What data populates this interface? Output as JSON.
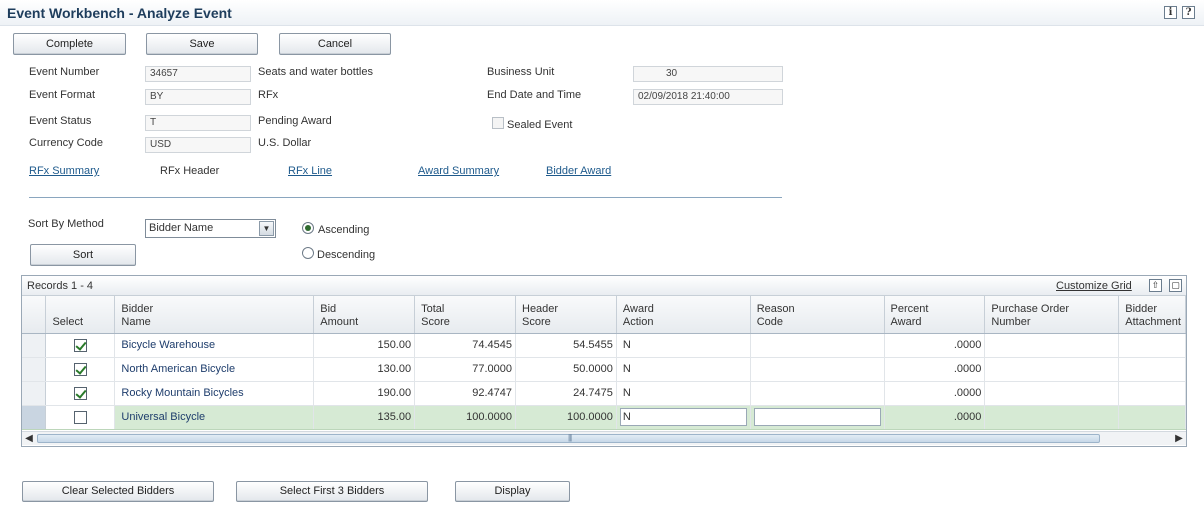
{
  "header": {
    "title": "Event Workbench - Analyze Event",
    "info_icon": "i",
    "help_icon": "?"
  },
  "toolbar": {
    "complete_label": "Complete",
    "save_label": "Save",
    "cancel_label": "Cancel"
  },
  "event": {
    "number_label": "Event Number",
    "number_value": "34657",
    "number_desc": "Seats and water bottles",
    "format_label": "Event Format",
    "format_value": "BY",
    "format_desc": "RFx",
    "status_label": "Event Status",
    "status_value": "T",
    "status_desc": "Pending Award",
    "currency_label": "Currency Code",
    "currency_value": "USD",
    "currency_desc": "U.S. Dollar",
    "business_unit_label": "Business Unit",
    "business_unit_value": "30",
    "end_date_label": "End Date and Time",
    "end_date_value": "02/09/2018 21:40:00",
    "sealed_label": "Sealed Event"
  },
  "nav_links": {
    "rfx_summary": "RFx Summary",
    "rfx_header": "RFx Header",
    "rfx_line": "RFx Line",
    "award_summary": "Award Summary",
    "bidder_award": "Bidder Award"
  },
  "sort": {
    "method_label": "Sort By Method",
    "method_value": "Bidder Name",
    "ascending_label": "Ascending",
    "descending_label": "Descending",
    "selected_order": "Ascending",
    "button_label": "Sort"
  },
  "grid": {
    "records_label": "Records 1 - 4",
    "customize_label": "Customize Grid",
    "columns": {
      "select": "Select",
      "bidder_name_1": "Bidder",
      "bidder_name_2": "Name",
      "bid_amount_1": "Bid",
      "bid_amount_2": "Amount",
      "total_score_1": "Total",
      "total_score_2": "Score",
      "header_score_1": "Header",
      "header_score_2": "Score",
      "award_action_1": "Award",
      "award_action_2": "Action",
      "reason_code_1": "Reason",
      "reason_code_2": "Code",
      "percent_award_1": "Percent",
      "percent_award_2": "Award",
      "po_number_1": "Purchase Order",
      "po_number_2": "Number",
      "bidder_attachment_1": "Bidder",
      "bidder_attachment_2": "Attachment"
    },
    "rows": [
      {
        "selected": true,
        "bidder_name": "Bicycle Warehouse",
        "bid_amount": "150.00",
        "total_score": "74.4545",
        "header_score": "54.5455",
        "award_action": "N",
        "reason_code": "",
        "percent_award": ".0000",
        "po_number": "",
        "bidder_attachment": ""
      },
      {
        "selected": true,
        "bidder_name": "North American Bicycle",
        "bid_amount": "130.00",
        "total_score": "77.0000",
        "header_score": "50.0000",
        "award_action": "N",
        "reason_code": "",
        "percent_award": ".0000",
        "po_number": "",
        "bidder_attachment": ""
      },
      {
        "selected": true,
        "bidder_name": "Rocky Mountain Bicycles",
        "bid_amount": "190.00",
        "total_score": "92.4747",
        "header_score": "24.7475",
        "award_action": "N",
        "reason_code": "",
        "percent_award": ".0000",
        "po_number": "",
        "bidder_attachment": ""
      },
      {
        "selected": false,
        "bidder_name": "Universal Bicycle",
        "bid_amount": "135.00",
        "total_score": "100.0000",
        "header_score": "100.0000",
        "award_action": "N",
        "reason_code": "",
        "percent_award": ".0000",
        "po_number": "",
        "bidder_attachment": ""
      }
    ]
  },
  "bottom_buttons": {
    "clear_selected": "Clear Selected Bidders",
    "select_first_3": "Select First 3 Bidders",
    "display": "Display"
  }
}
